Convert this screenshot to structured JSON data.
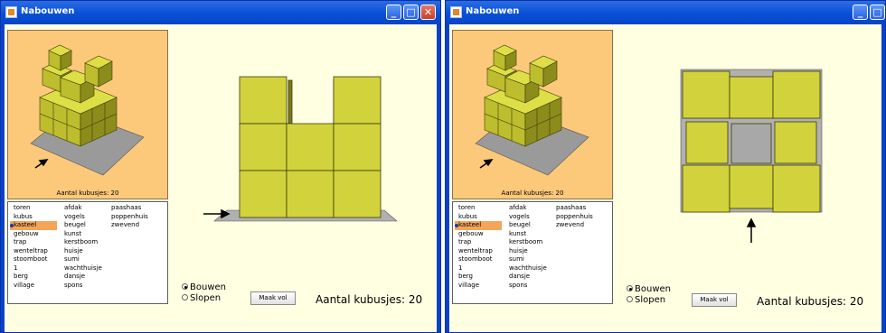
{
  "windows": [
    {
      "title": "Nabouwen",
      "preview_count": "Aantal kubusjes: 20",
      "list_columns": [
        [
          "toren",
          "kubus",
          "kasteel",
          "gebouw",
          "trap",
          "wenteltrap",
          "stoomboot",
          "1",
          "berg",
          "village"
        ],
        [
          "afdak",
          "vogels",
          "beugel",
          "kunst",
          "kerstboom",
          "huisje",
          "sumi",
          "wachthuisje",
          "dansje",
          "spons"
        ],
        [
          "paashaas",
          "poppenhuis",
          "zwevend"
        ]
      ],
      "selected_item": "kasteel",
      "radio_build": "Bouwen",
      "radio_break": "Slopen",
      "fill_button": "Maak vol",
      "count_label": "Aantal kubusjes: 20",
      "mode": "Bouwen",
      "view": "front"
    },
    {
      "title": "Nabouwen",
      "preview_count": "Aantal kubusjes: 20",
      "list_columns": [
        [
          "toren",
          "kubus",
          "kasteel",
          "gebouw",
          "trap",
          "wenteltrap",
          "stoomboot",
          "1",
          "berg",
          "village"
        ],
        [
          "afdak",
          "vogels",
          "beugel",
          "kunst",
          "kerstboom",
          "huisje",
          "sumi",
          "wachthuisje",
          "dansje",
          "spons"
        ],
        [
          "paashaas",
          "poppenhuis",
          "zwevend"
        ]
      ],
      "selected_item": "kasteel",
      "radio_build": "Bouwen",
      "radio_break": "Slopen",
      "fill_button": "Maak vol",
      "count_label": "Aantal kubusjes: 20",
      "mode": "Bouwen",
      "view": "top"
    }
  ],
  "colors": {
    "cube_face": "#d2d23c",
    "cube_side": "#9c9c22",
    "preview_bg": "#fcc87a",
    "client_bg": "#ffffe2",
    "selection": "#f5a55a"
  }
}
